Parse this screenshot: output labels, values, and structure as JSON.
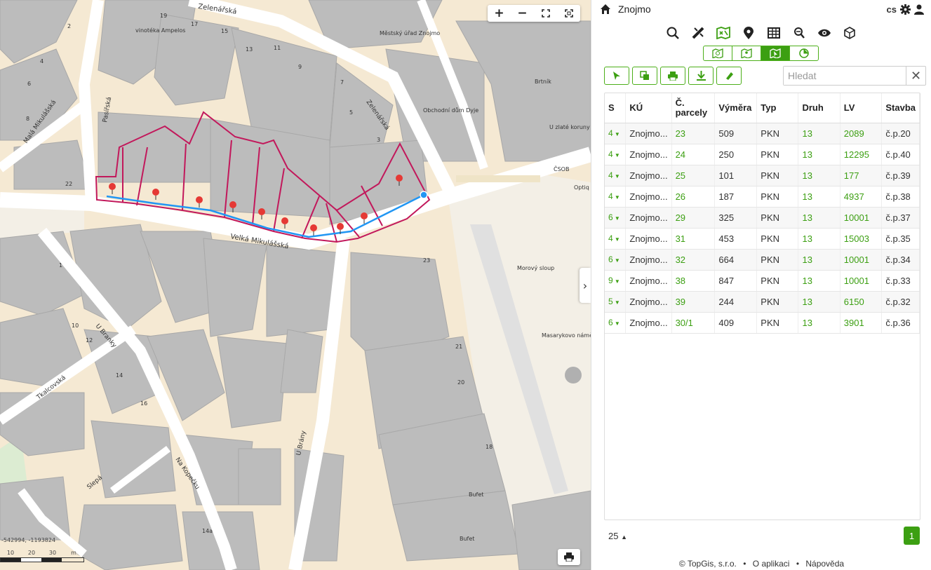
{
  "map": {
    "controls": {
      "zoom_in": "+",
      "zoom_out": "−"
    },
    "coordinates": "-542994, -1193824",
    "scale": {
      "labels": [
        "10",
        "20",
        "30"
      ],
      "unit": "m"
    },
    "streets": [
      "Zelenářská",
      "Pasířská",
      "Malá Mikulášská",
      "Velká Mikulášská",
      "U Branky",
      "Tkalcovská",
      "U Brány",
      "Na Kopečku",
      "Slepá",
      "Zelenářská"
    ],
    "pois": [
      "vinotéka Ampelos",
      "Městský úřad Znojmo",
      "Obchodní dům Dyje",
      "Brtník",
      "U zlaté koruny",
      "ČSOB",
      "Optiq central plus",
      "Morový sloup",
      "Masarykovo náměstí",
      "Bufet",
      "Bufet"
    ],
    "house_numbers": [
      "19",
      "17",
      "15",
      "13",
      "11",
      "9",
      "7",
      "5",
      "3",
      "2",
      "4",
      "6",
      "8",
      "22",
      "1",
      "10",
      "12",
      "14",
      "16",
      "20",
      "21",
      "23",
      "18",
      "14a"
    ]
  },
  "panel": {
    "title": "Znojmo",
    "lang": "cs",
    "search": {
      "placeholder": "Hledat"
    },
    "table": {
      "headers": [
        "S",
        "KÚ",
        "Č. parcely",
        "Výměra",
        "Typ",
        "Druh",
        "LV",
        "Stavba"
      ],
      "rows": [
        {
          "s": "4",
          "ku": "Znojmo...",
          "parcela": "23",
          "vymera": "509",
          "typ": "PKN",
          "druh": "13",
          "lv": "2089",
          "stavba": "č.p.20"
        },
        {
          "s": "4",
          "ku": "Znojmo...",
          "parcela": "24",
          "vymera": "250",
          "typ": "PKN",
          "druh": "13",
          "lv": "12295",
          "stavba": "č.p.40"
        },
        {
          "s": "4",
          "ku": "Znojmo...",
          "parcela": "25",
          "vymera": "101",
          "typ": "PKN",
          "druh": "13",
          "lv": "177",
          "stavba": "č.p.39"
        },
        {
          "s": "4",
          "ku": "Znojmo...",
          "parcela": "26",
          "vymera": "187",
          "typ": "PKN",
          "druh": "13",
          "lv": "4937",
          "stavba": "č.p.38"
        },
        {
          "s": "6",
          "ku": "Znojmo...",
          "parcela": "29",
          "vymera": "325",
          "typ": "PKN",
          "druh": "13",
          "lv": "10001",
          "stavba": "č.p.37"
        },
        {
          "s": "4",
          "ku": "Znojmo...",
          "parcela": "31",
          "vymera": "453",
          "typ": "PKN",
          "druh": "13",
          "lv": "15003",
          "stavba": "č.p.35"
        },
        {
          "s": "6",
          "ku": "Znojmo...",
          "parcela": "32",
          "vymera": "664",
          "typ": "PKN",
          "druh": "13",
          "lv": "10001",
          "stavba": "č.p.34"
        },
        {
          "s": "9",
          "ku": "Znojmo...",
          "parcela": "38",
          "vymera": "847",
          "typ": "PKN",
          "druh": "13",
          "lv": "10001",
          "stavba": "č.p.33"
        },
        {
          "s": "5",
          "ku": "Znojmo...",
          "parcela": "39",
          "vymera": "244",
          "typ": "PKN",
          "druh": "13",
          "lv": "6150",
          "stavba": "č.p.32"
        },
        {
          "s": "6",
          "ku": "Znojmo...",
          "parcela": "30/1",
          "vymera": "409",
          "typ": "PKN",
          "druh": "13",
          "lv": "3901",
          "stavba": "č.p.36"
        }
      ]
    },
    "page_size": "25",
    "current_page": "1",
    "footer": {
      "copyright": "© TopGis, s.r.o.",
      "sep": "•",
      "about": "O aplikaci",
      "help": "Nápověda"
    }
  },
  "colors": {
    "accent": "#3c9f12",
    "parcel_outline": "#c2185b",
    "route": "#2196f3",
    "building": "#bcbcbc"
  }
}
